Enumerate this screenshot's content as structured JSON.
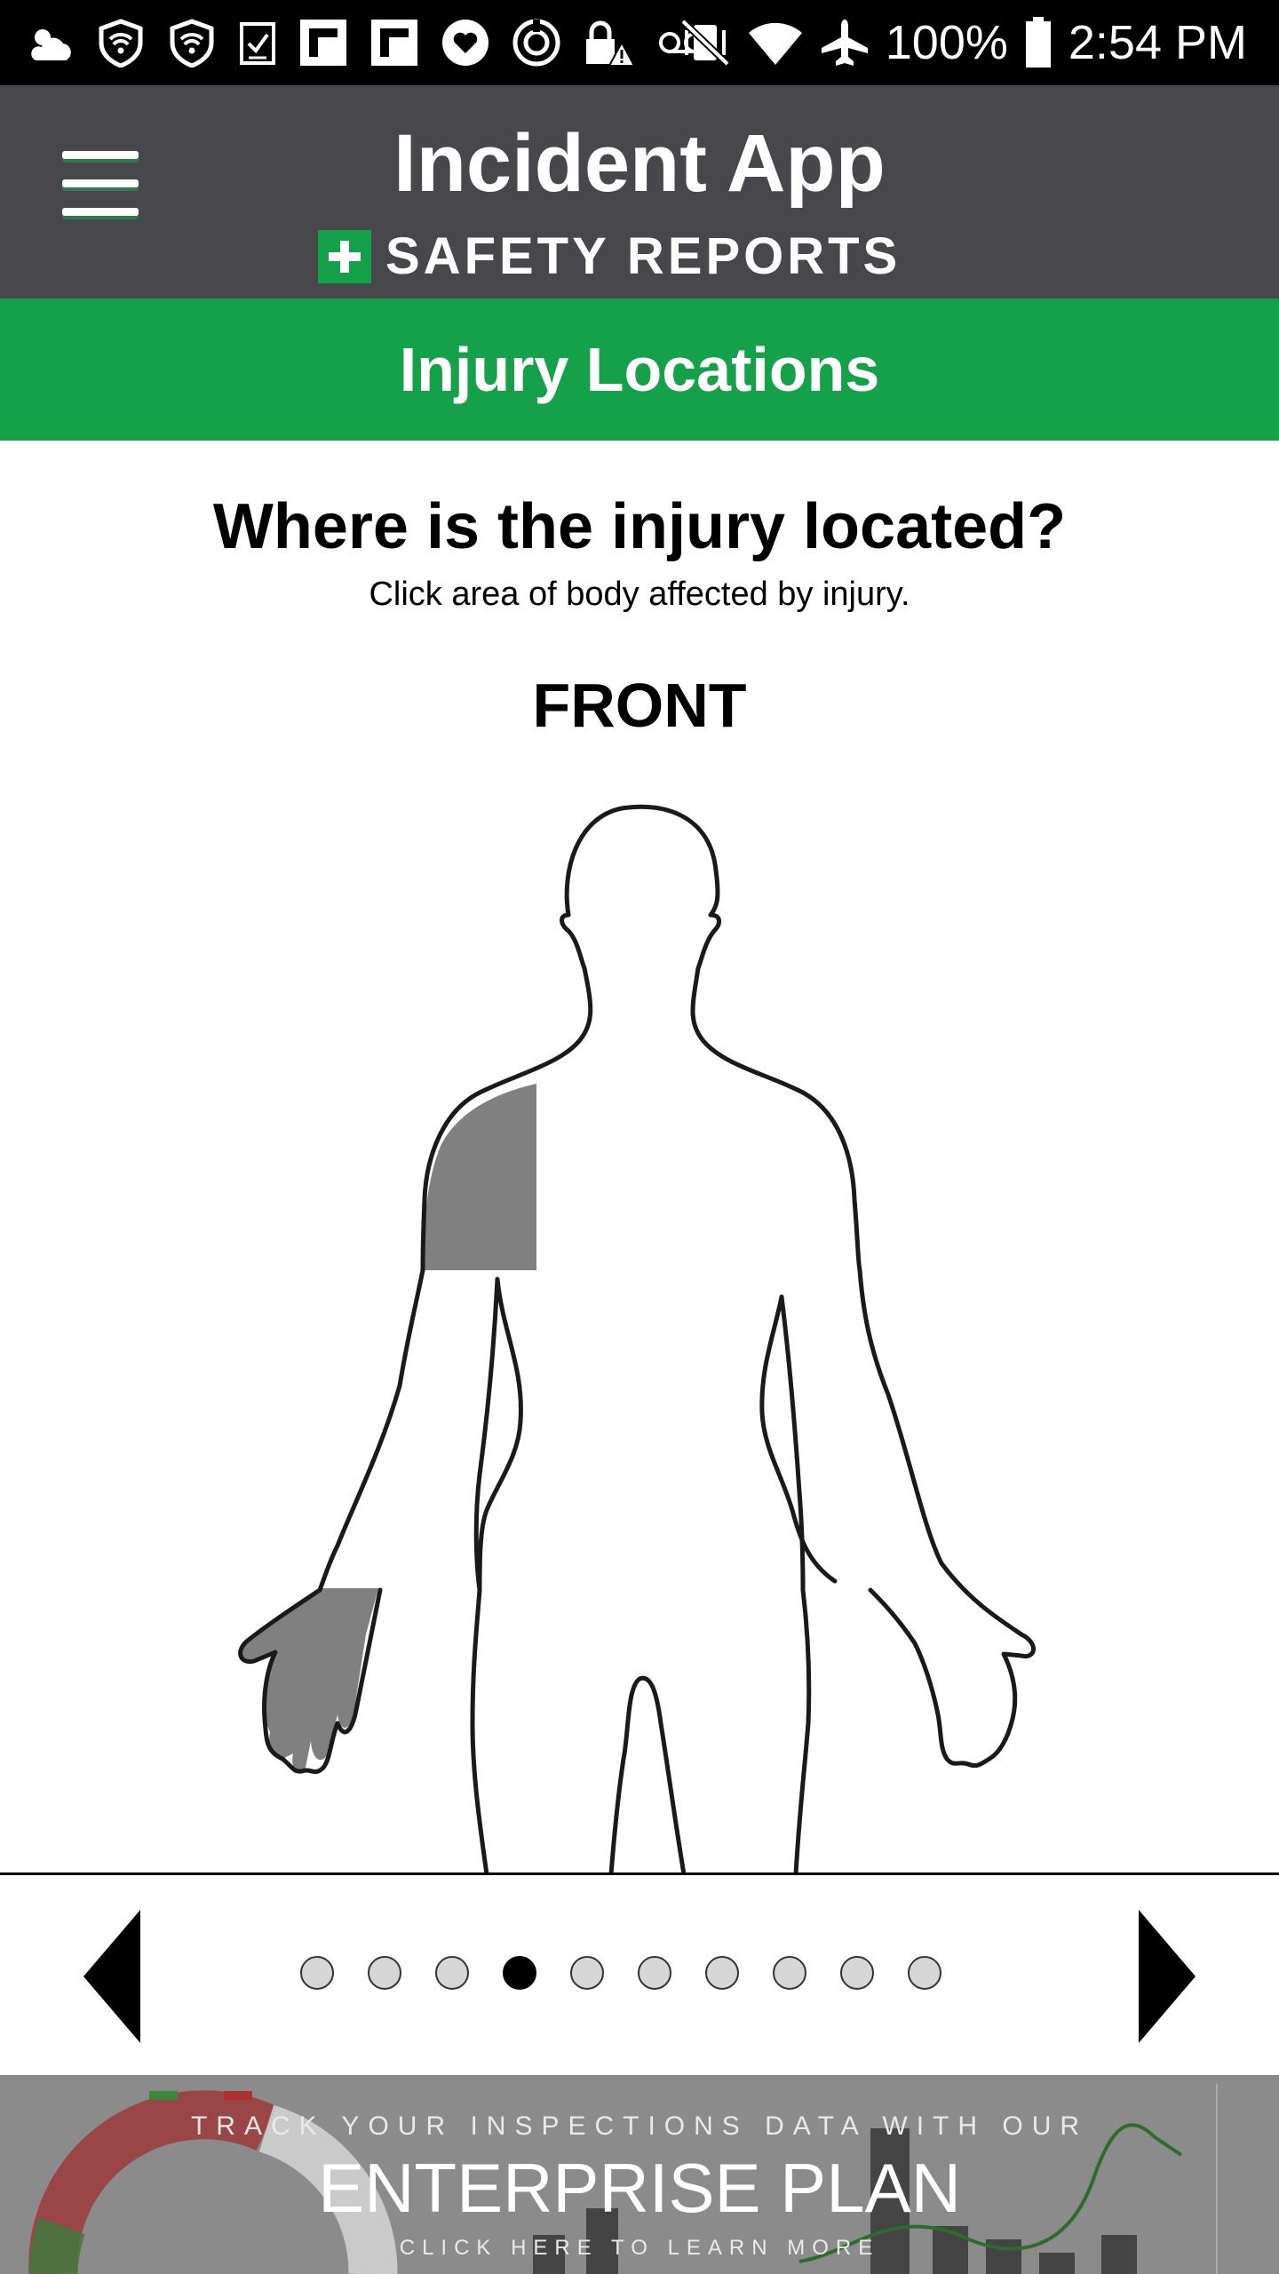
{
  "status_bar": {
    "icons": [
      "weather-partly-cloudy-icon",
      "shield-wifi-icon",
      "shield-wifi-icon",
      "task-check-icon",
      "flipboard-icon",
      "flipboard-icon",
      "heart-app-icon",
      "sync-circle-icon",
      "lock-warning-icon",
      "voicemail-icon"
    ],
    "right_icons": [
      "vibrate-mute-icon",
      "wifi-icon",
      "airplane-icon",
      "battery-icon"
    ],
    "battery": "100%",
    "time": "2:54 PM"
  },
  "header": {
    "title": "Incident App",
    "brand": "SAFETY REPORTS",
    "menu_icon": "hamburger-menu-icon"
  },
  "section": {
    "title": "Injury Locations"
  },
  "content": {
    "question": "Where is the injury located?",
    "instruction": "Click area of body affected by injury.",
    "view_label": "FRONT",
    "selected_regions": [
      "right-shoulder",
      "right-hand"
    ]
  },
  "pager": {
    "page_count": 10,
    "current_page": 4,
    "prev_icon": "triangle-left-icon",
    "next_icon": "triangle-right-icon"
  },
  "ad": {
    "line1": "TRACK YOUR INSPECTIONS DATA WITH OUR",
    "line2": "ENTERPRISE PLAN",
    "line3": "CLICK HERE TO LEARN MORE"
  },
  "colors": {
    "header_bg": "#48474b",
    "accent_green": "#14a14a",
    "selected_region": "#808080"
  }
}
